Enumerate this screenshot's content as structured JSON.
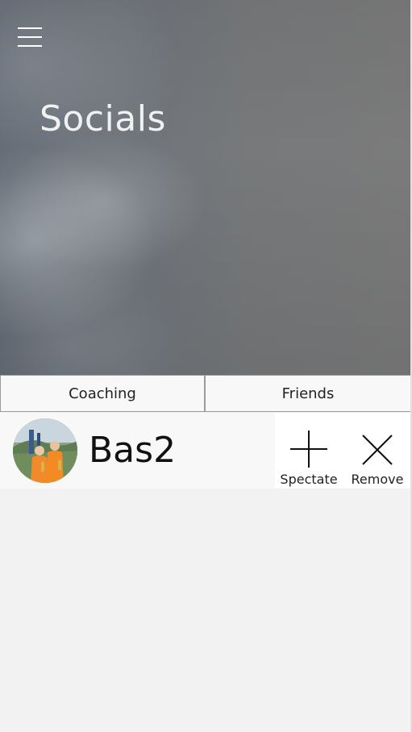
{
  "header": {
    "title": "Socials",
    "menu_icon": "hamburger-menu-icon"
  },
  "tabs": [
    {
      "label": "Coaching"
    },
    {
      "label": "Friends"
    }
  ],
  "friends": [
    {
      "name": "Bas2",
      "actions": {
        "spectate_label": "Spectate",
        "spectate_icon": "plus-icon",
        "remove_label": "Remove",
        "remove_icon": "close-icon"
      }
    }
  ]
}
